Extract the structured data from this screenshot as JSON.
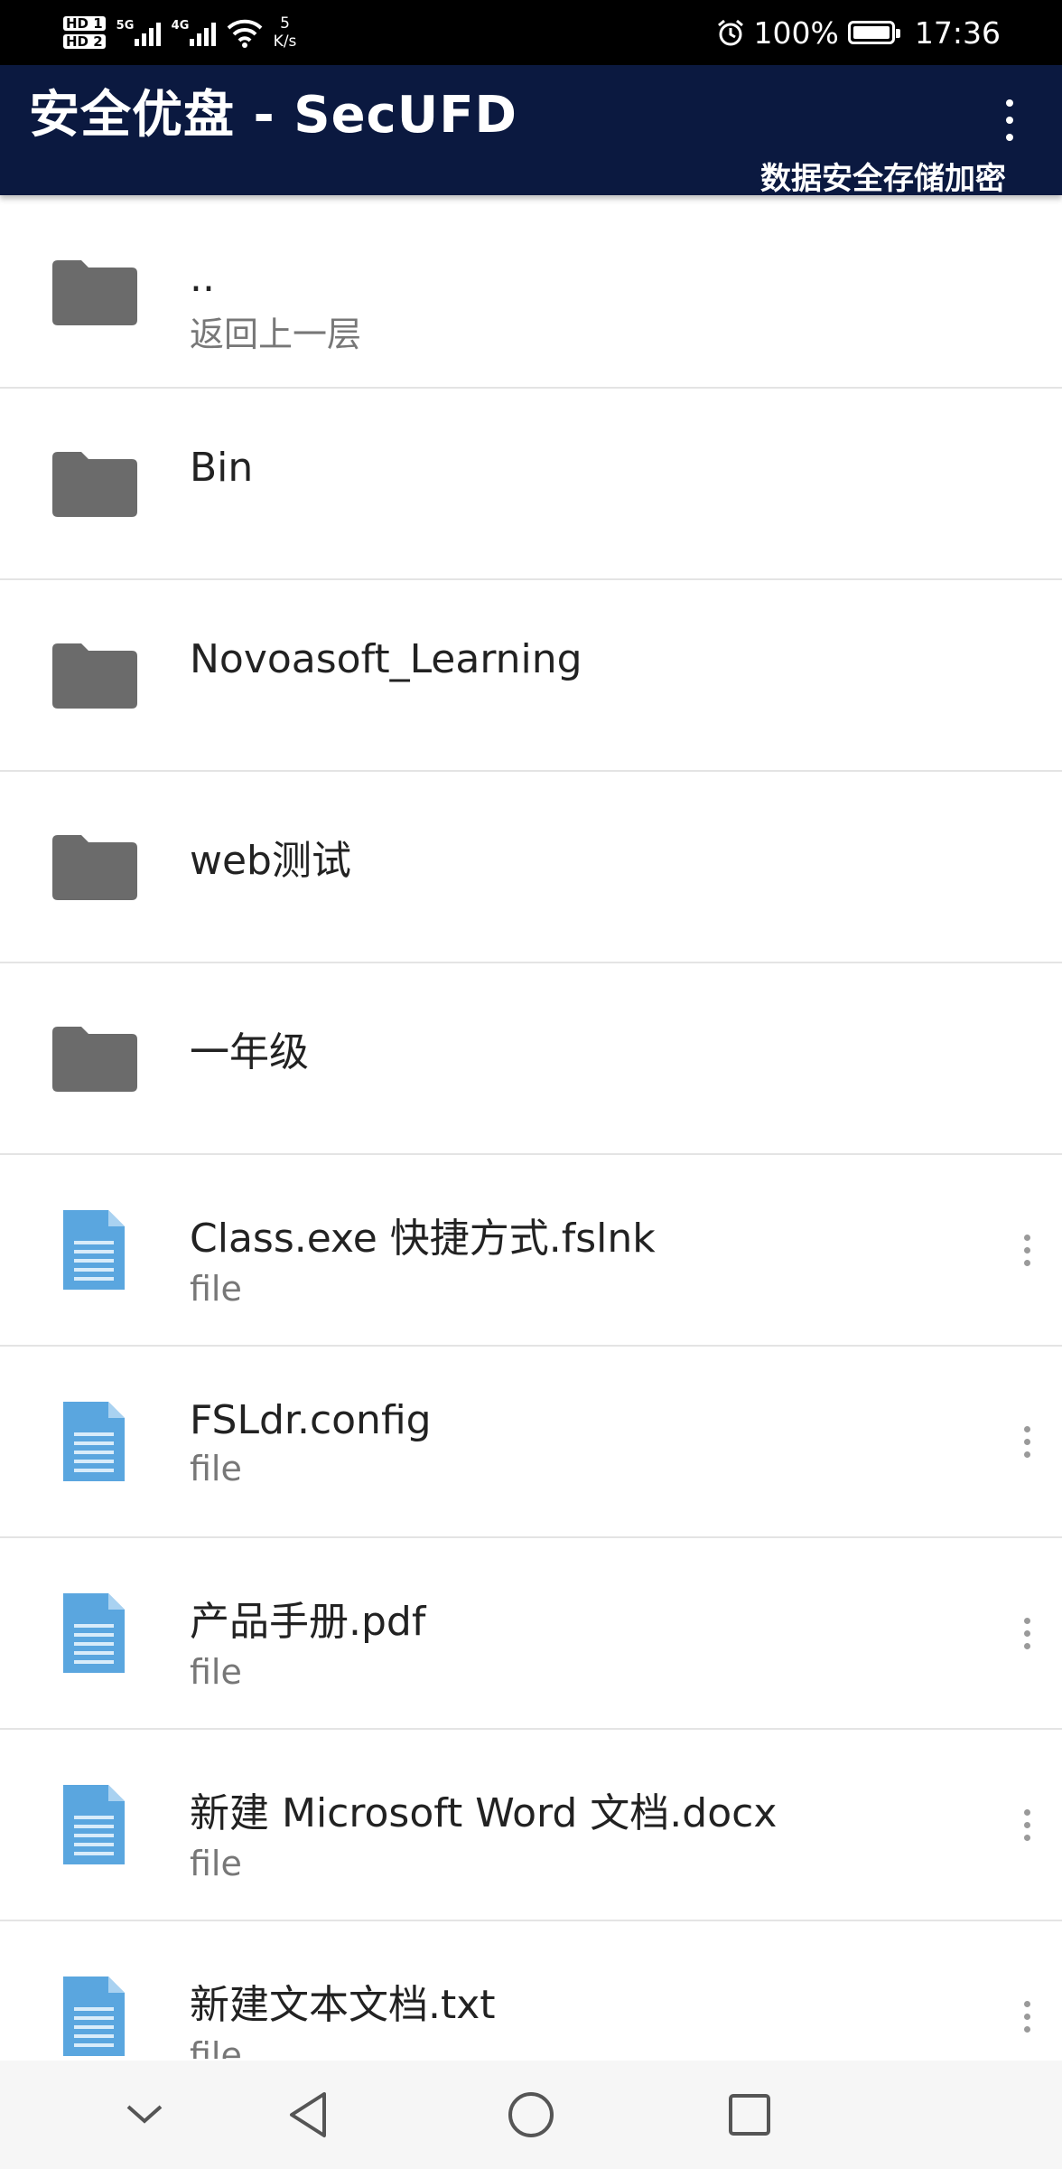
{
  "status_bar": {
    "hd1": "HD 1",
    "hd2": "HD 2",
    "net1": "5G",
    "net2": "4G",
    "speed_value": "5",
    "speed_unit": "K/s",
    "battery": "100%",
    "time": "17:36"
  },
  "app_bar": {
    "title": "安全优盘 - SecUFD",
    "subtitle": "数据安全存储加密",
    "overflow_icon": "more-vertical-icon"
  },
  "file_list": {
    "items": [
      {
        "name": "..",
        "subtitle": "返回上一层",
        "kind": "folder"
      },
      {
        "name": "Bin",
        "subtitle": "",
        "kind": "folder"
      },
      {
        "name": "Novoasoft_Learning",
        "subtitle": "",
        "kind": "folder"
      },
      {
        "name": "web测试",
        "subtitle": "",
        "kind": "folder"
      },
      {
        "name": "一年级",
        "subtitle": "",
        "kind": "folder"
      },
      {
        "name": "Class.exe 快捷方式.fslnk",
        "subtitle": "file",
        "kind": "file"
      },
      {
        "name": "FSLdr.config",
        "subtitle": "file",
        "kind": "file"
      },
      {
        "name": "产品手册.pdf",
        "subtitle": "file",
        "kind": "file"
      },
      {
        "name": "新建 Microsoft Word 文档.docx",
        "subtitle": "file",
        "kind": "file"
      },
      {
        "name": "新建文本文档.txt",
        "subtitle": "file",
        "kind": "file"
      }
    ]
  },
  "colors": {
    "app_bar": "#0b1940",
    "folder_icon": "#6b6b6b",
    "file_icon": "#5aa6df"
  },
  "nav_bar": {
    "icons": [
      "chevron-down-icon",
      "back-triangle-icon",
      "home-circle-icon",
      "recents-square-icon"
    ]
  }
}
